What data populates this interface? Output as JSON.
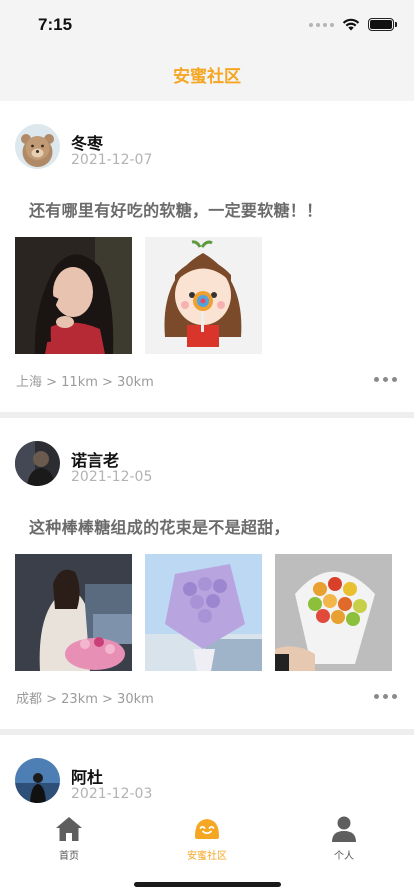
{
  "status": {
    "time": "7:15"
  },
  "header": {
    "title": "安蜜社区"
  },
  "posts": [
    {
      "username": "冬枣",
      "date": "2021-12-07",
      "content": "还有哪里有好吃的软糖，一定要软糖！！",
      "location": "上海 > 11km > 30km"
    },
    {
      "username": "诺言老",
      "date": "2021-12-05",
      "content": "这种棒棒糖组成的花束是不是超甜，",
      "location": "成都 > 23km > 30km"
    },
    {
      "username": "阿杜",
      "date": "2021-12-03"
    }
  ],
  "tabbar": {
    "items": [
      {
        "label": "首页",
        "icon": "home-icon"
      },
      {
        "label": "安蜜社区",
        "icon": "smile-face-icon"
      },
      {
        "label": "个人",
        "icon": "person-icon"
      }
    ]
  },
  "colors": {
    "accent": "#f5a623",
    "divider": "#eeeeef",
    "muted": "#b3b3b3"
  }
}
